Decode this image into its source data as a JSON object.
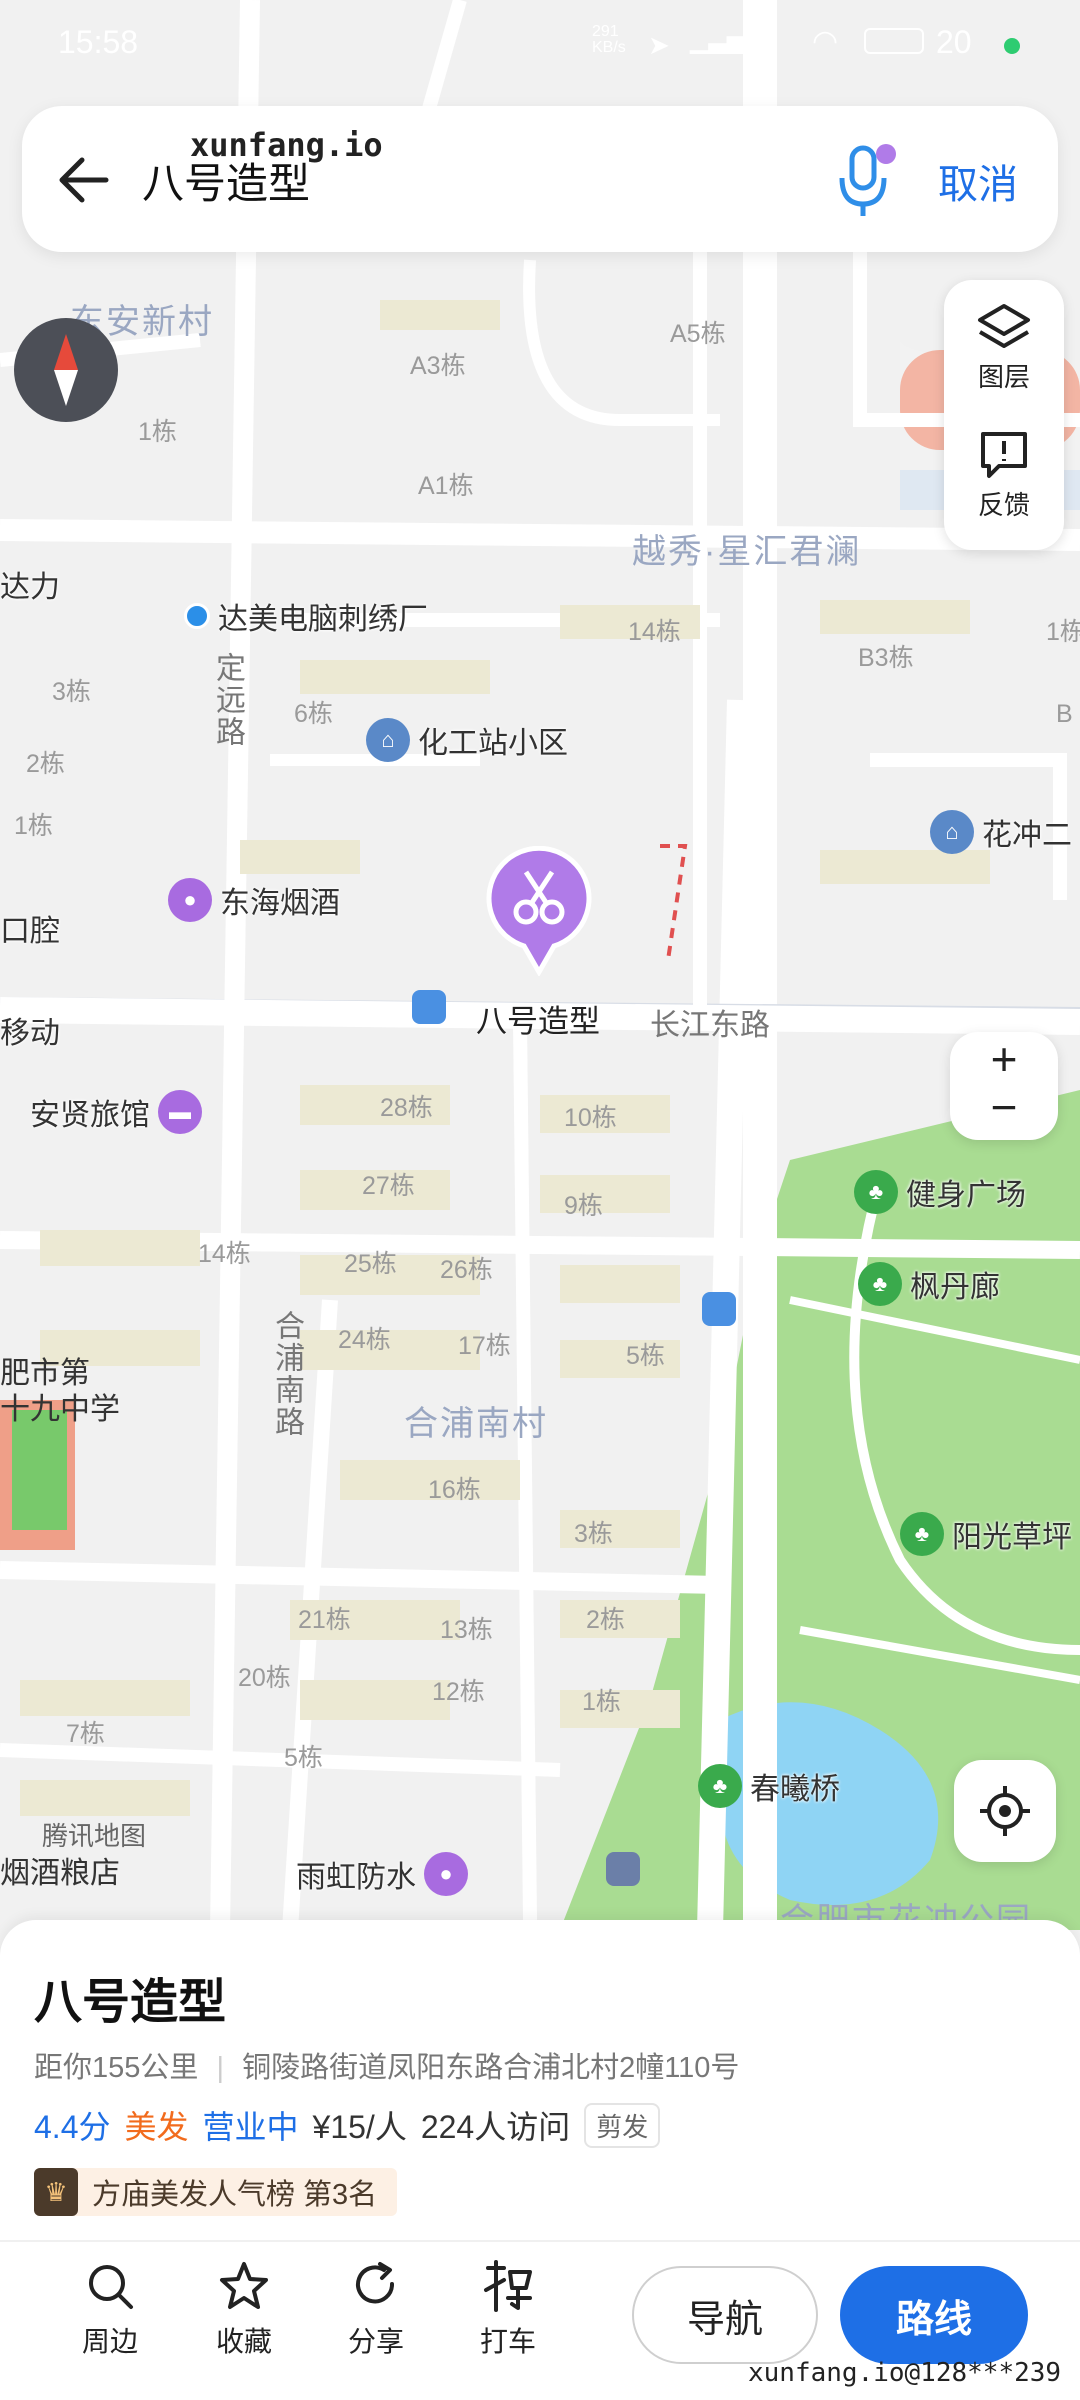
{
  "status_bar": {
    "time": "15:58",
    "net_speed": "291\nKB/s",
    "battery": "20",
    "indicator_color": "#2ecc71"
  },
  "watermark": {
    "top": "xunfang.io",
    "bottom": "xunfang.io@128***239"
  },
  "search": {
    "back_icon": "arrow-left-icon",
    "query": "八号造型",
    "voice_icon": "microphone-icon",
    "cancel": "取消"
  },
  "map_controls": {
    "layers": "图层",
    "feedback": "反馈",
    "zoom_in": "+",
    "zoom_out": "−",
    "compass_icon": "compass-icon",
    "locate_icon": "locate-icon"
  },
  "map": {
    "area_labels": [
      "东安新村",
      "越秀·星汇君澜",
      "合浦南村",
      "合肥市花冲公园"
    ],
    "roads": [
      "长江东路",
      "定远路",
      "合浦南路"
    ],
    "buildings": [
      "A5栋",
      "A3栋",
      "A1栋",
      "1栋",
      "14栋",
      "B3栋",
      "3栋",
      "6栋",
      "2栋",
      "1栋",
      "28栋",
      "10栋",
      "27栋",
      "9栋",
      "14栋",
      "25栋",
      "26栋",
      "24栋",
      "17栋",
      "5栋",
      "16栋",
      "3栋",
      "21栋",
      "13栋",
      "2栋",
      "20栋",
      "12栋",
      "1栋",
      "7栋",
      "5栋",
      "1栋",
      "B"
    ],
    "pois": [
      {
        "name": "达美电脑刺绣厂"
      },
      {
        "name": "化工站小区"
      },
      {
        "name": "东海烟酒"
      },
      {
        "name": "安贤旅馆"
      },
      {
        "name": "健身广场"
      },
      {
        "name": "枫丹廊"
      },
      {
        "name": "阳光草坪"
      },
      {
        "name": "春曦桥"
      },
      {
        "name": "雨虹防水"
      },
      {
        "name": "花冲二"
      },
      {
        "name": "八号造型"
      }
    ],
    "edge_labels": [
      "达力",
      "口腔",
      "移动",
      "肥市第\n十九中学",
      "腾讯地图",
      "烟酒粮店",
      "1栋"
    ],
    "selected_marker_icon": "scissors-icon",
    "accent_color": "#b07be8"
  },
  "place": {
    "name": "八号造型",
    "distance": "距你155公里",
    "address": "铜陵路街道凤阳东路合浦北村2幢110号",
    "rating": "4.4分",
    "category": "美发",
    "open_status": "营业中",
    "price": "¥15/人",
    "visits": "224人访问",
    "tag": "剪发",
    "rank": "方庙美发人气榜 第3名"
  },
  "toolbar": {
    "nearby": "周边",
    "favorite": "收藏",
    "share": "分享",
    "taxi": "打车",
    "navigate": "导航",
    "route": "路线"
  },
  "colors": {
    "primary": "#1e6fe6",
    "orange": "#f26b1d",
    "park": "#a8db8f",
    "water": "#8fd4f4"
  }
}
